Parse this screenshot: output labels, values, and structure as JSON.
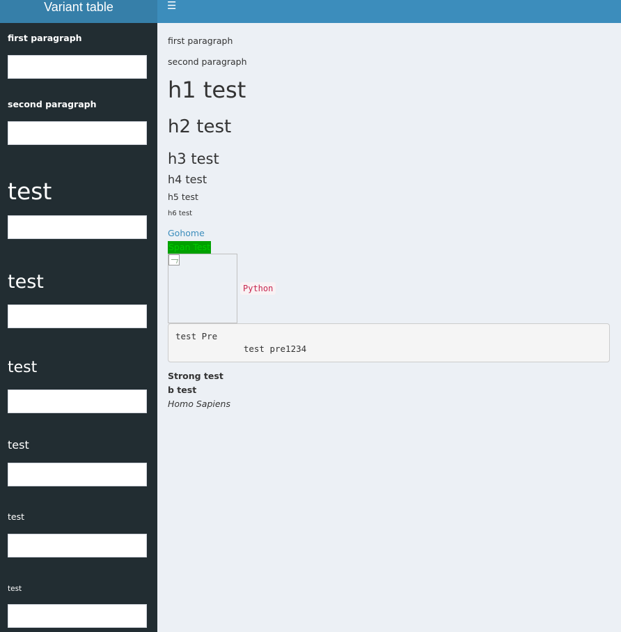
{
  "app": {
    "title": "Variant table"
  },
  "header": {
    "toggle_icon": "hamburger-icon"
  },
  "sidebar": {
    "fields": [
      {
        "label": "first paragraph",
        "value": "",
        "level": "p"
      },
      {
        "label": "second paragraph",
        "value": "",
        "level": "p"
      },
      {
        "label": "test",
        "value": "",
        "level": "h1"
      },
      {
        "label": "test",
        "value": "",
        "level": "h2"
      },
      {
        "label": "test",
        "value": "",
        "level": "h3"
      },
      {
        "label": "test",
        "value": "",
        "level": "h4"
      },
      {
        "label": "test",
        "value": "",
        "level": "h5"
      },
      {
        "label": "test",
        "value": "",
        "level": "h6"
      }
    ]
  },
  "content": {
    "p1": "first paragraph",
    "p2": "second paragraph",
    "h1": "h1 test",
    "h2": "h2 test",
    "h3": "h3 test",
    "h4": "h4 test",
    "h5": "h5 test",
    "h6": "h6 test",
    "link": "Gohome",
    "span": "Span Test",
    "code_inline": "Python",
    "pre": "test Pre\n             test pre1234",
    "strong": "Strong test",
    "b": "b test",
    "em": "Homo Sapiens"
  },
  "colors": {
    "sidebar_bg": "#222d32",
    "header_bg": "#3c8dbc",
    "brand_bg": "#367fa9",
    "link": "#3c8dbc",
    "span_bg": "#00a000",
    "code": "#c7254e"
  }
}
